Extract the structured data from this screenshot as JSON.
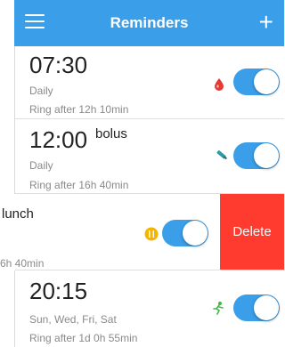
{
  "header": {
    "title": "Reminders",
    "menu_icon": "hamburger-menu-icon",
    "add_icon": "plus-icon"
  },
  "colors": {
    "accent": "#3a9ee8",
    "delete": "#ff3b30",
    "drop": "#e53935",
    "pen": "#2e9aa8",
    "fork": "#f5b400",
    "run": "#43b649"
  },
  "reminders": [
    {
      "time": "07:30",
      "name": "",
      "repeat": "Daily",
      "ring": "Ring after 12h 10min",
      "icon": "blood-drop-icon",
      "enabled": true
    },
    {
      "time": "12:00",
      "name": "bolus",
      "repeat": "Daily",
      "ring": "Ring after 16h 40min",
      "icon": "insulin-pen-icon",
      "enabled": true
    },
    {
      "time": "",
      "name": "lunch",
      "repeat": "",
      "ring": "6h 40min",
      "icon": "meal-icon",
      "enabled": true,
      "delete_label": "Delete"
    },
    {
      "time": "20:15",
      "name": "",
      "repeat": "Sun, Wed, Fri, Sat",
      "ring": "Ring after 1d 0h 55min",
      "icon": "exercise-icon",
      "enabled": true
    }
  ]
}
